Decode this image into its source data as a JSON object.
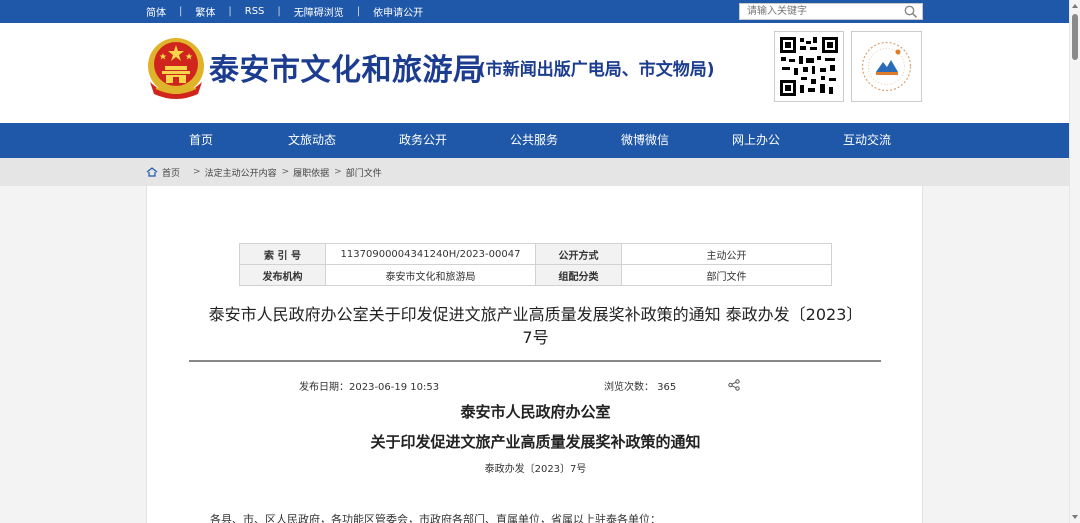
{
  "topbar": {
    "links": [
      "简体",
      "繁体",
      "RSS",
      "无障碍浏览",
      "依申请公开"
    ],
    "search_placeholder": "请输入关键字"
  },
  "header": {
    "title": "泰安市文化和旅游局",
    "subtitle": "(市新闻出版广电局、市文物局)"
  },
  "nav": {
    "items": [
      "首页",
      "文旅动态",
      "政务公开",
      "公共服务",
      "微博微信",
      "网上办公",
      "互动交流"
    ]
  },
  "breadcrumb": {
    "home": "首页",
    "items": [
      "法定主动公开内容",
      "履职依据",
      "部门文件"
    ]
  },
  "meta": {
    "index_label": "索 引 号",
    "index_value": "11370900004341240H/2023-00047",
    "mode_label": "公开方式",
    "mode_value": "主动公开",
    "issuer_label": "发布机构",
    "issuer_value": "泰安市文化和旅游局",
    "category_label": "组配分类",
    "category_value": "部门文件"
  },
  "document": {
    "title": "泰安市人民政府办公室关于印发促进文旅产业高质量发展奖补政策的通知 泰政办发〔2023〕7号",
    "publish_date": "发布日期：2023-06-19 10:53",
    "views": "浏览次数： 365",
    "heading_line1": "泰安市人民政府办公室",
    "heading_line2": "关于印发促进文旅产业高质量发展奖补政策的通知",
    "doc_number": "泰政办发〔2023〕7号",
    "addressee": "各县、市、区人民政府，各功能区管委会，市政府各部门、直属单位，省属以上驻泰各单位："
  },
  "colors": {
    "primary_blue": "#1f58a8",
    "title_blue": "#1c3d8f"
  }
}
